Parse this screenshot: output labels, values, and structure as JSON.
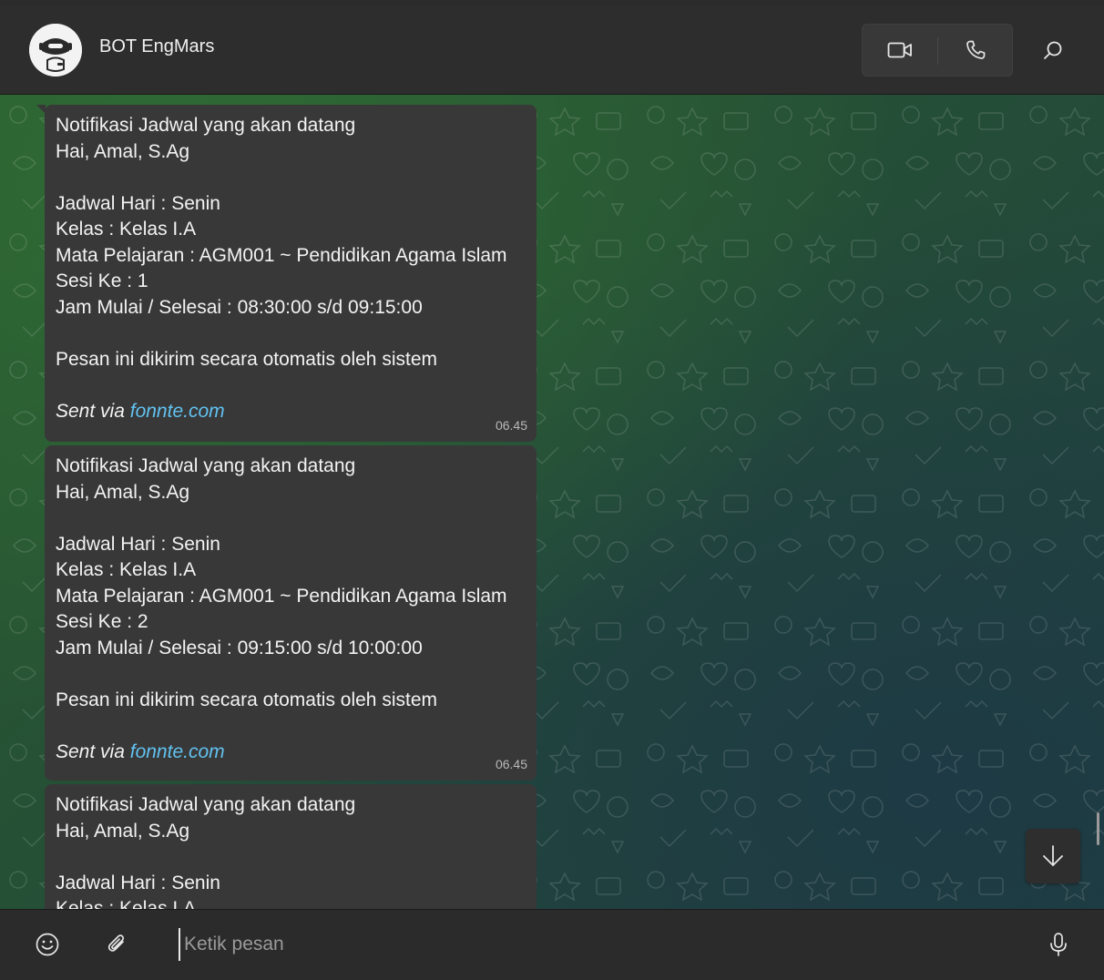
{
  "header": {
    "contact_name": "BOT EngMars",
    "video_icon": "video-camera-icon",
    "voice_icon": "phone-icon",
    "search_icon": "search-icon"
  },
  "messages": [
    {
      "lines": [
        "Notifikasi Jadwal yang akan datang",
        "Hai, Amal, S.Ag",
        "",
        "Jadwal Hari : Senin",
        "Kelas : Kelas I.A",
        "Mata Pelajaran : AGM001 ~ Pendidikan Agama Islam",
        "Sesi Ke : 1",
        "Jam Mulai / Selesai : 08:30:00 s/d 09:15:00",
        "",
        "Pesan ini dikirim secara otomatis oleh sistem",
        ""
      ],
      "sent_via": "Sent via",
      "link": "fonnte.com",
      "time": "06.45"
    },
    {
      "lines": [
        "Notifikasi Jadwal yang akan datang",
        "Hai, Amal, S.Ag",
        "",
        "Jadwal Hari : Senin",
        "Kelas : Kelas I.A",
        "Mata Pelajaran : AGM001 ~ Pendidikan Agama Islam",
        "Sesi Ke : 2",
        "Jam Mulai / Selesai : 09:15:00 s/d 10:00:00",
        "",
        "Pesan ini dikirim secara otomatis oleh sistem",
        ""
      ],
      "sent_via": "Sent via",
      "link": "fonnte.com",
      "time": "06.45"
    },
    {
      "lines": [
        "Notifikasi Jadwal yang akan datang",
        "Hai, Amal, S.Ag",
        "",
        "Jadwal Hari : Senin",
        "Kelas : Kelas I.A"
      ]
    }
  ],
  "composer": {
    "placeholder": "Ketik pesan",
    "emoji_icon": "emoji-icon",
    "attach_icon": "paperclip-icon",
    "mic_icon": "microphone-icon"
  },
  "colors": {
    "bubble": "#383838",
    "link": "#61c2f0",
    "header": "#2d2d2d",
    "wallpaper": "#2a5a30"
  }
}
